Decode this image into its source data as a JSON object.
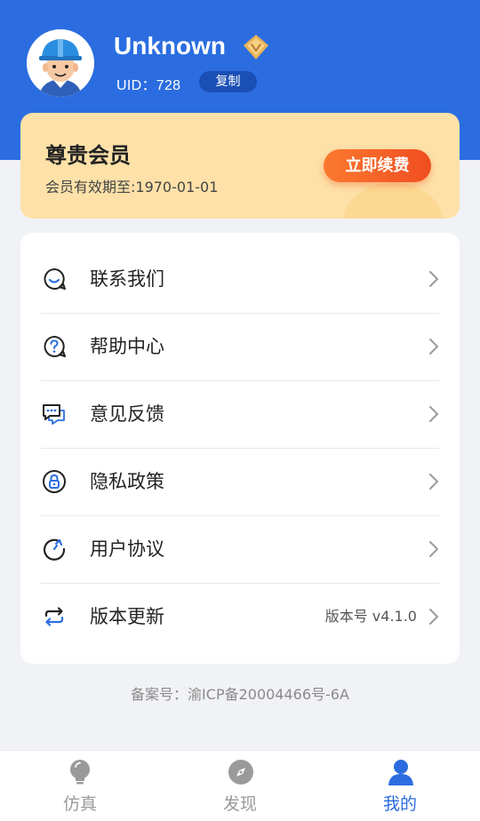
{
  "profile": {
    "username": "Unknown",
    "uid": "UID：728",
    "copy_label": "复制",
    "avatar_icon": "worker-avatar-icon",
    "vip_icon": "gold-diamond-icon"
  },
  "vip": {
    "title": "尊贵会员",
    "expire": "会员有效期至:1970-01-01",
    "renew_label": "立即续费"
  },
  "menu": {
    "items": [
      {
        "label": "联系我们",
        "icon": "smile-chat-icon"
      },
      {
        "label": "帮助中心",
        "icon": "help-question-icon"
      },
      {
        "label": "意见反馈",
        "icon": "feedback-chat-icon"
      },
      {
        "label": "隐私政策",
        "icon": "privacy-lock-icon"
      },
      {
        "label": "用户协议",
        "icon": "agreement-refresh-icon"
      },
      {
        "label": "版本更新",
        "icon": "update-sync-icon",
        "extra": "版本号 v4.1.0"
      }
    ]
  },
  "footer": {
    "icp": "备案号：渝ICP备20004466号-6A"
  },
  "tabbar": {
    "tabs": [
      {
        "label": "仿真",
        "icon": "bulb-icon",
        "active": false
      },
      {
        "label": "发现",
        "icon": "compass-icon",
        "active": false
      },
      {
        "label": "我的",
        "icon": "user-icon",
        "active": true
      }
    ]
  },
  "colors": {
    "primary": "#2b6de0",
    "vip_bg": "#fde1a8",
    "renew_gradient_start": "#fb7a2f",
    "renew_gradient_end": "#f04d20",
    "accent_icon": "#2b6de0"
  }
}
